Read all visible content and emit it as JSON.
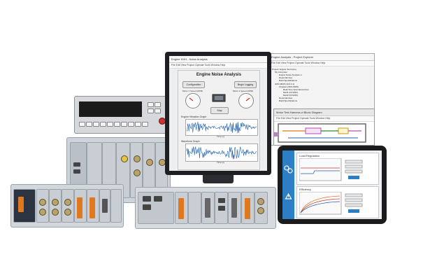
{
  "monitor_app": {
    "window_title": "Engine NVH - Noise Analysis",
    "menu": "File  Edit  View  Project  Operate  Tools  Window  Help",
    "heading": "Engine Noise Analysis",
    "buttons": {
      "configuration": "Configuration",
      "begin_logging": "Begin Logging",
      "stop": "Stop"
    },
    "gauges": {
      "left_label": "Motor 1 Speed (RPM)",
      "right_label": "Motor 2 Speed (RPM)"
    },
    "plots": {
      "top_title": "Engine Vibration Graph",
      "top_xlabel": "Time (s)",
      "top_ylabel": "Amplitude",
      "bottom_title": "Waveform Graph",
      "bottom_xlabel": "Time (s)",
      "bottom_ylabel": "Amplitude"
    }
  },
  "project_window": {
    "title": "Engine Analysis - Project Explorer",
    "menu": "File  Edit  View  Project  Operate  Tools  Window  Help",
    "tree": [
      "Project: Engine Test.lvproj",
      "My Computer",
      "Engine Noise Analysis.vi",
      "Dependencies",
      "Build Specifications",
      "cRIO-9045 (10.0.0.1)",
      "Chassis (cRIO-9045)",
      "Real-Time Scan Resources",
      "Mod1 (NI 9234)",
      "Mod2 (NI 9215)",
      "Dependencies",
      "Build Specifications"
    ]
  },
  "block_diagram": {
    "title": "Motor Test Harness.vi Block Diagram",
    "menu": "File  Edit  View  Project  Operate  Tools  Window  Help"
  },
  "tablet": {
    "card1_title": "Load Regulation",
    "card2_title": "Efficiency"
  },
  "colors": {
    "signal_blue": "#1f5fae",
    "tablet_accent": "#2c7fc4",
    "module_orange": "#e0781e"
  }
}
